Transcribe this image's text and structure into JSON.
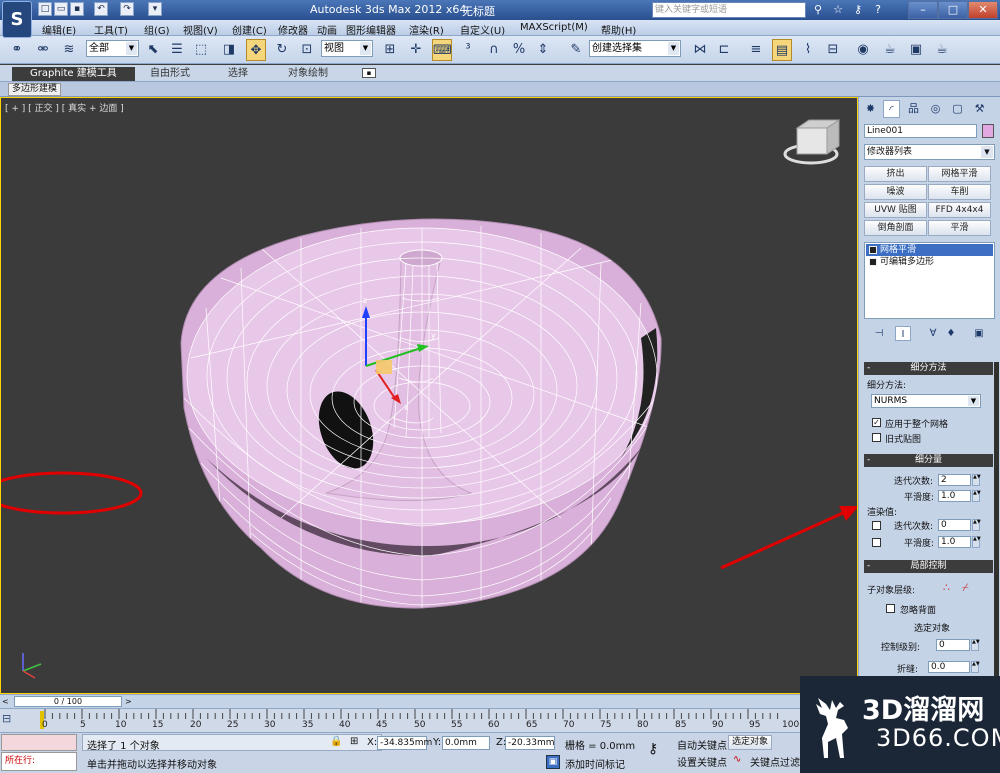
{
  "window": {
    "app_logo": "S",
    "title": "Autodesk 3ds Max  2012 x64",
    "document": "无标题",
    "search_placeholder": "键入关键字或短语"
  },
  "menu": [
    "编辑(E)",
    "工具(T)",
    "组(G)",
    "视图(V)",
    "创建(C)",
    "修改器",
    "动画",
    "图形编辑器",
    "渲染(R)",
    "自定义(U)",
    "MAXScript(M)",
    "帮助(H)"
  ],
  "toolbar": {
    "selection_filter": "全部",
    "reference_coord": "视图",
    "named_selection": "创建选择集"
  },
  "ribbon": {
    "tabs": [
      "Graphite 建模工具",
      "自由形式",
      "选择",
      "对象绘制"
    ],
    "sub_label": "多边形建模"
  },
  "viewport": {
    "label": "[ + ] [ 正交 ] [ 真实 + 边面 ]",
    "object_color": "#e6b8e6",
    "wire_color": "#ffffff",
    "gizmo_axes": {
      "x": "x",
      "y": "y",
      "z": "z"
    }
  },
  "command_panel": {
    "object_name": "Line001",
    "object_color": "#e2a8e2",
    "modifier_list": "修改器列表",
    "modifier_buttons": [
      "挤出",
      "网格平滑",
      "噪波",
      "车削",
      "UVW 贴图",
      "FFD 4x4x4",
      "倒角剖面",
      "平滑"
    ],
    "stack": [
      {
        "label": "网格平滑",
        "selected": true
      },
      {
        "label": "可编辑多边形",
        "selected": false
      }
    ],
    "rollout_subdivision_method": {
      "title": "细分方法",
      "method_label": "细分方法:",
      "method_value": "NURMS",
      "apply_to_whole_mesh": "应用于整个网格",
      "apply_checked": true,
      "old_style_mapping": "旧式贴图",
      "old_checked": false
    },
    "rollout_subdivision_amount": {
      "title": "细分量",
      "iterations_label": "迭代次数:",
      "iterations_value": "2",
      "smoothness_label": "平滑度:",
      "smoothness_value": "1.0",
      "render_label": "渲染值:",
      "render_iterations_label": "迭代次数:",
      "render_iterations_value": "0",
      "render_smoothness_label": "平滑度:",
      "render_smoothness_value": "1.0"
    },
    "rollout_local_control": {
      "title": "局部控制",
      "sub_level_label": "子对象层级:",
      "ignore_backfacing": "忽略背面",
      "selected_object": "选定对象",
      "control_level_label": "控制级别:",
      "control_level_value": "0",
      "crease_label": "折缝:",
      "crease_value": "0.0"
    }
  },
  "timeline": {
    "frame_display": "0 / 100",
    "ticks": [
      "0",
      "5",
      "10",
      "15",
      "20",
      "25",
      "30",
      "35",
      "40",
      "45",
      "50",
      "55",
      "60",
      "65",
      "70",
      "75",
      "80",
      "85",
      "90",
      "95",
      "100"
    ]
  },
  "status": {
    "maxscript_running": "所在行:",
    "selection_text": "选择了 1 个对象",
    "prompt_text": "单击并拖动以选择并移动对象",
    "x_label": "X:",
    "x_value": "-34.835mm",
    "y_label": "Y:",
    "y_value": "0.0mm",
    "z_label": "Z:",
    "z_value": "-20.33mm",
    "grid_text": "栅格 = 0.0mm",
    "add_time_tag": "添加时间标记",
    "auto_key": "自动关键点",
    "set_key": "设置关键点",
    "selected_object": "选定对象",
    "key_filters": "关键点过滤"
  },
  "watermark": {
    "title": "3D溜溜网",
    "url": "3D66.COM"
  }
}
